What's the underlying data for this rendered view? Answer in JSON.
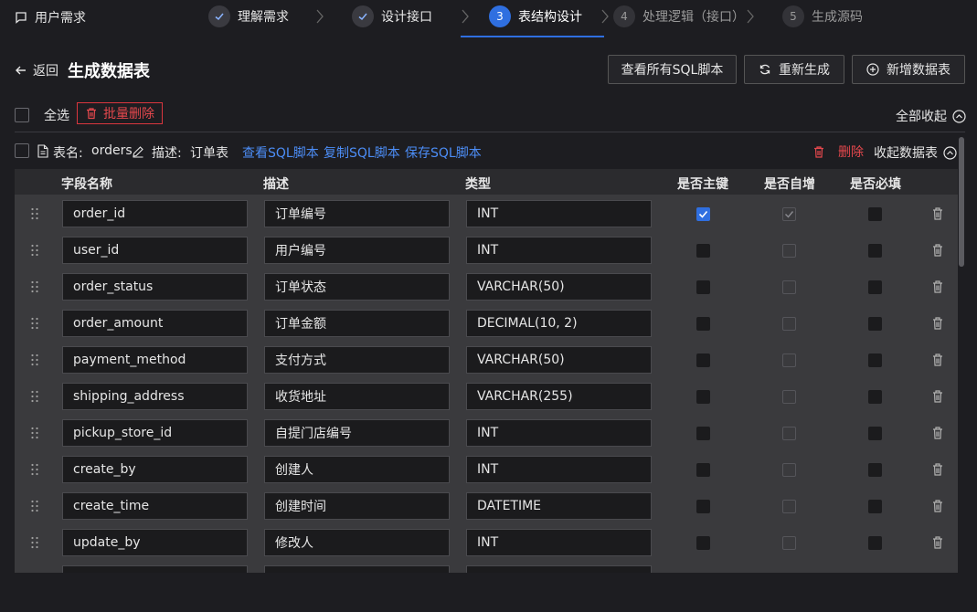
{
  "app": {
    "title": "用户需求"
  },
  "steps": [
    {
      "num": "1",
      "label": "理解需求",
      "state": "done"
    },
    {
      "num": "2",
      "label": "设计接口",
      "state": "done"
    },
    {
      "num": "3",
      "label": "表结构设计",
      "state": "active"
    },
    {
      "num": "4",
      "label": "处理逻辑（接口）",
      "state": "todo"
    },
    {
      "num": "5",
      "label": "生成源码",
      "state": "todo"
    }
  ],
  "header": {
    "back_label": "返回",
    "title": "生成数据表",
    "btn_view_sql": "查看所有SQL脚本",
    "btn_regen": "重新生成",
    "btn_add_table": "新增数据表"
  },
  "toolbar": {
    "select_all": "全选",
    "batch_delete": "批量删除",
    "collapse_all": "全部收起"
  },
  "table": {
    "name_label": "表名:",
    "name": "orders",
    "desc_label": "描述:",
    "desc": "订单表",
    "link_view_sql": "查看SQL脚本",
    "link_copy_sql": "复制SQL脚本",
    "link_save_sql": "保存SQL脚本",
    "delete_label": "删除",
    "collapse_label": "收起数据表"
  },
  "columns": {
    "field": "字段名称",
    "desc": "描述",
    "type": "类型",
    "pk": "是否主键",
    "ai": "是否自增",
    "req": "是否必填"
  },
  "fields": [
    {
      "name": "order_id",
      "desc": "订单编号",
      "type": "INT",
      "pk": true,
      "ai": true,
      "req": false
    },
    {
      "name": "user_id",
      "desc": "用户编号",
      "type": "INT",
      "pk": false,
      "ai": false,
      "req": false
    },
    {
      "name": "order_status",
      "desc": "订单状态",
      "type": "VARCHAR(50)",
      "pk": false,
      "ai": false,
      "req": false
    },
    {
      "name": "order_amount",
      "desc": "订单金额",
      "type": "DECIMAL(10, 2)",
      "pk": false,
      "ai": false,
      "req": false
    },
    {
      "name": "payment_method",
      "desc": "支付方式",
      "type": "VARCHAR(50)",
      "pk": false,
      "ai": false,
      "req": false
    },
    {
      "name": "shipping_address",
      "desc": "收货地址",
      "type": "VARCHAR(255)",
      "pk": false,
      "ai": false,
      "req": false
    },
    {
      "name": "pickup_store_id",
      "desc": "自提门店编号",
      "type": "INT",
      "pk": false,
      "ai": false,
      "req": false
    },
    {
      "name": "create_by",
      "desc": "创建人",
      "type": "INT",
      "pk": false,
      "ai": false,
      "req": false
    },
    {
      "name": "create_time",
      "desc": "创建时间",
      "type": "DATETIME",
      "pk": false,
      "ai": false,
      "req": false
    },
    {
      "name": "update_by",
      "desc": "修改人",
      "type": "INT",
      "pk": false,
      "ai": false,
      "req": false
    },
    {
      "name": "",
      "desc": "",
      "type": "",
      "pk": false,
      "ai": false,
      "req": false
    }
  ],
  "colors": {
    "accent": "#2f6fe0",
    "link": "#4c8df6",
    "danger": "#e5484d",
    "bg": "#1d1d21",
    "panel": "#3a3a3d"
  }
}
